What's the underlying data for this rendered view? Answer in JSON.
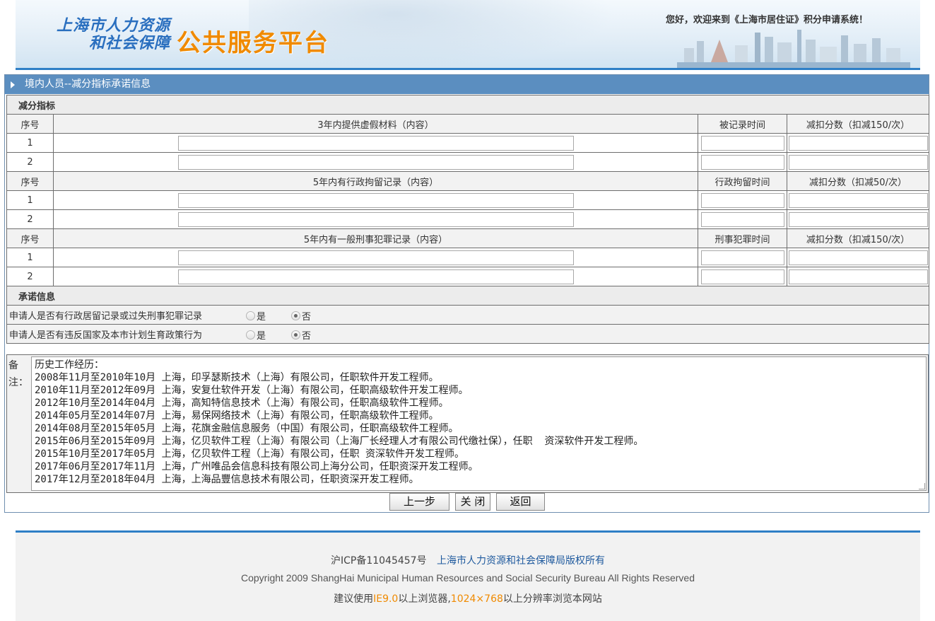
{
  "header": {
    "logo_line1": "上海市人力资源",
    "logo_line2": "和社会保障",
    "logo_platform": "公共服务平台",
    "welcome": "您好，欢迎来到《上海市居住证》积分申请系统！"
  },
  "panel_title": "境内人员--减分指标承诺信息",
  "deduction": {
    "section_label": "减分指标",
    "blocks": [
      {
        "seq_header": "序号",
        "content_header": "3年内提供虚假材料（内容）",
        "time_header": "被记录时间",
        "score_header": "减扣分数（扣减150/次）",
        "rows": [
          {
            "seq": "1",
            "content": "",
            "time": "",
            "score": ""
          },
          {
            "seq": "2",
            "content": "",
            "time": "",
            "score": ""
          }
        ]
      },
      {
        "seq_header": "序号",
        "content_header": "5年内有行政拘留记录（内容）",
        "time_header": "行政拘留时间",
        "score_header": "减扣分数（扣减50/次）",
        "rows": [
          {
            "seq": "1",
            "content": "",
            "time": "",
            "score": ""
          },
          {
            "seq": "2",
            "content": "",
            "time": "",
            "score": ""
          }
        ]
      },
      {
        "seq_header": "序号",
        "content_header": "5年内有一般刑事犯罪记录（内容）",
        "time_header": "刑事犯罪时间",
        "score_header": "减扣分数（扣减150/次）",
        "rows": [
          {
            "seq": "1",
            "content": "",
            "time": "",
            "score": ""
          },
          {
            "seq": "2",
            "content": "",
            "time": "",
            "score": ""
          }
        ]
      }
    ]
  },
  "commitment": {
    "section_label": "承诺信息",
    "questions": [
      {
        "label": "申请人是否有行政居留记录或过失刑事犯罪记录",
        "yes": "是",
        "no": "否",
        "selected": "否"
      },
      {
        "label": "申请人是否有违反国家及本市计划生育政策行为",
        "yes": "是",
        "no": "否",
        "selected": "否"
      }
    ]
  },
  "remark": {
    "label": "备注：",
    "text": "历史工作经历：\n2008年11月至2010年10月 上海，印孚瑟斯技术（上海）有限公司，任职软件开发工程师。\n2010年11月至2012年09月 上海，安复仕软件开发（上海）有限公司，任职高级软件开发工程师。\n2012年10月至2014年04月 上海，高知特信息技术（上海）有限公司，任职高级软件工程师。\n2014年05月至2014年07月 上海，易保网络技术（上海）有限公司，任职高级软件工程师。\n2014年08月至2015年05月 上海，花旗金融信息服务（中国）有限公司，任职高级软件工程师。\n2015年06月至2015年09月 上海，亿贝软件工程（上海）有限公司（上海厂长经理人才有限公司代缴社保），任职  资深软件开发工程师。\n2015年10月至2017年05月 上海，亿贝软件工程（上海）有限公司，任职 资深软件开发工程师。\n2017年06月至2017年11月 上海，广州唯品会信息科技有限公司上海分公司，任职资深开发工程师。\n2017年12月至2018年04月 上海，上海品豐信息技术有限公司，任职资深开发工程师。"
  },
  "buttons": {
    "prev": "上一步",
    "close": "关 闭",
    "back": "返回"
  },
  "footer": {
    "icp": "沪ICP备11045457号",
    "owner": "上海市人力资源和社会保障局版权所有",
    "copyright": "Copyright 2009 ShangHai Municipal Human Resources and Social Security Bureau All Rights Reserved",
    "tip_pre": "建议使用",
    "tip_browser": "IE9.0",
    "tip_mid": "以上浏览器,",
    "tip_res": "1024×768",
    "tip_post": "以上分辨率浏览本网站"
  },
  "colors": {
    "title_bar": "#5b8ec0",
    "accent_orange": "#f08a00",
    "link_blue": "#1f5a9e",
    "rule_blue": "#2f7fc6"
  }
}
